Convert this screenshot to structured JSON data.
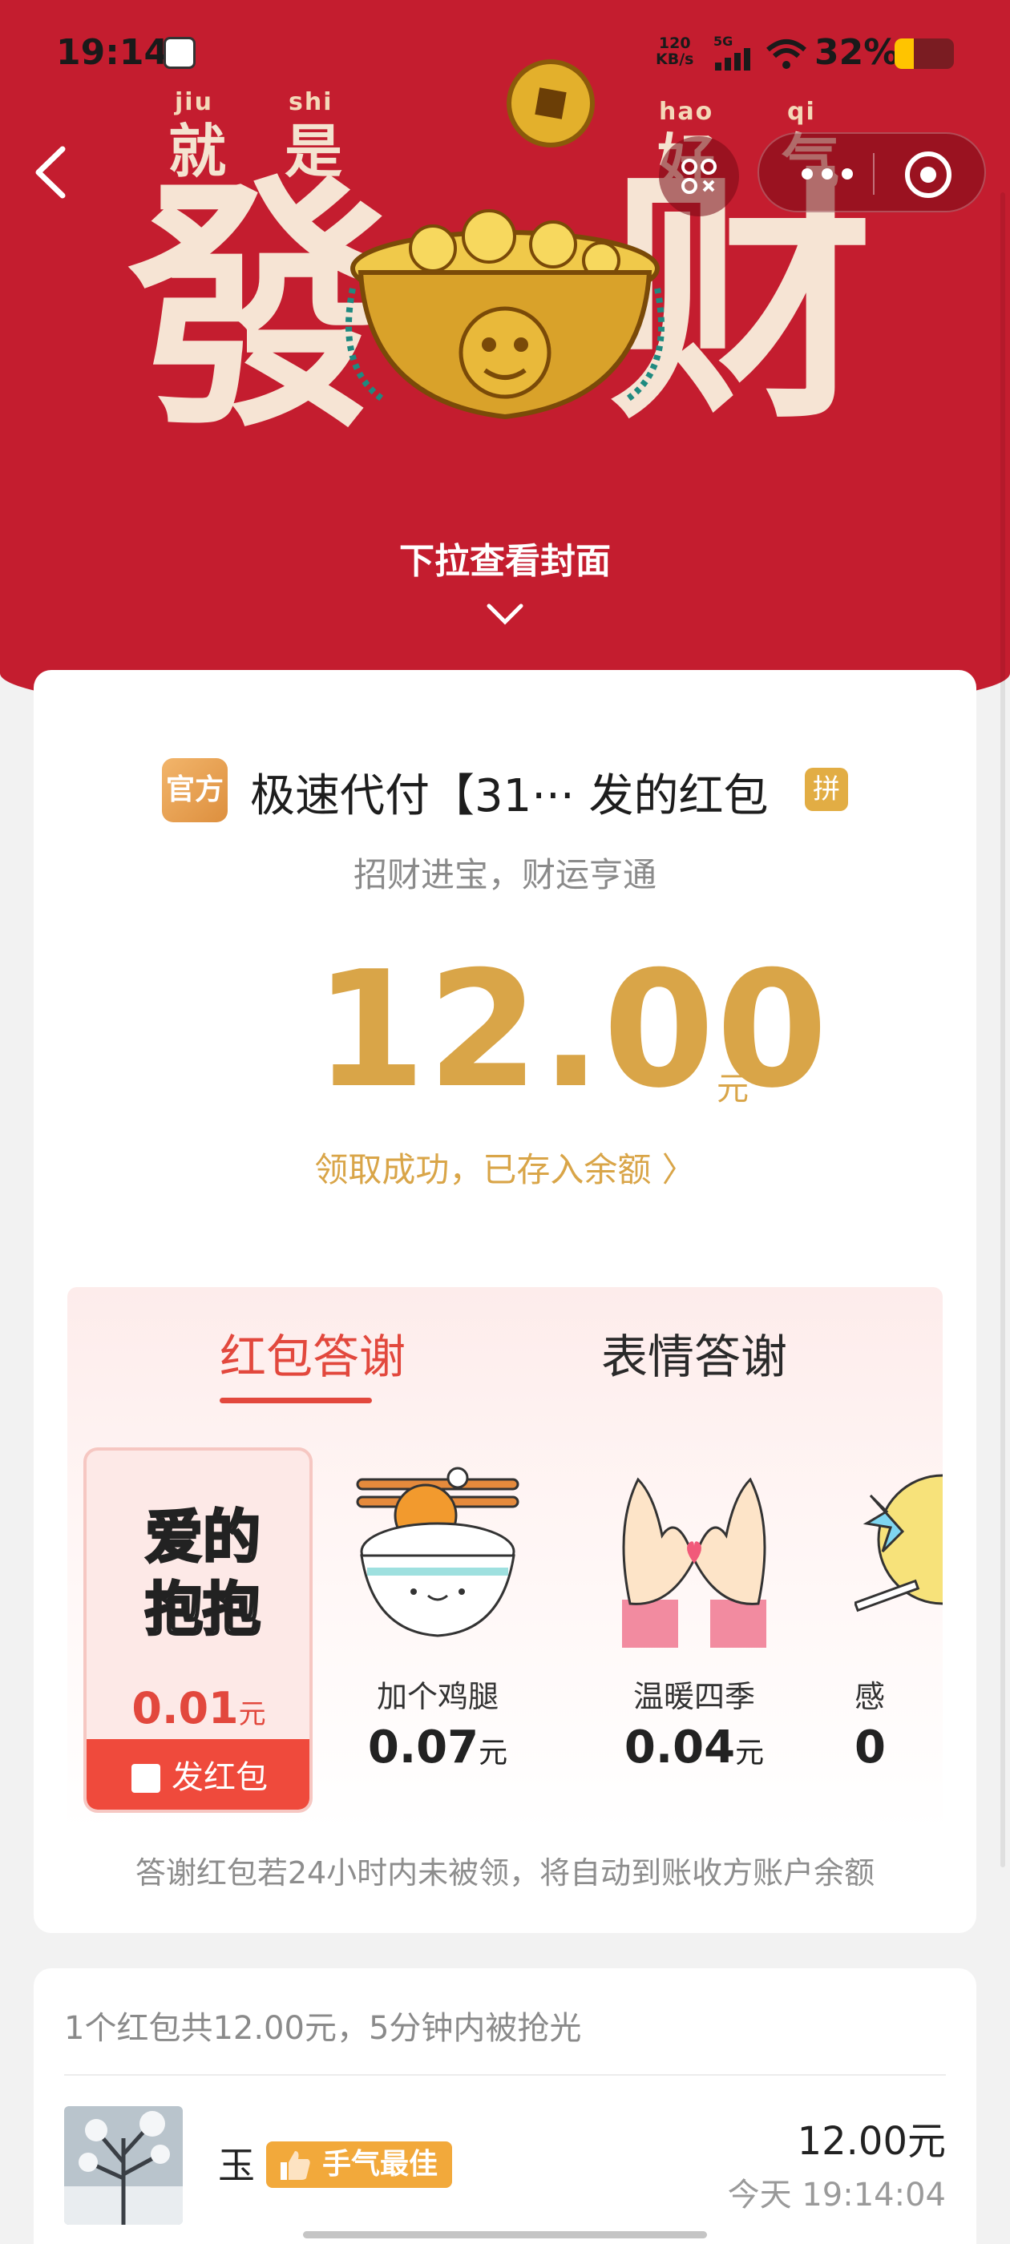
{
  "status_bar": {
    "time": "19:14",
    "net_speed_value": "120",
    "net_speed_unit": "KB/s",
    "network_type": "5G",
    "battery_percent": "32%",
    "battery_level": 0.32
  },
  "nav": {
    "back_icon": "chevron-left-icon",
    "more_icon": "more-dots-icon",
    "close_icon": "target-close-icon",
    "share_icon": "share-icon"
  },
  "cover": {
    "pinyin_1": "jiu",
    "pinyin_2": "shi",
    "pinyin_3": "hao",
    "pinyin_4": "qi",
    "char_1": "就",
    "char_2": "是",
    "char_3": "好",
    "char_4": "气",
    "big_left": "發",
    "big_right": "财"
  },
  "pull_hint": "下拉查看封面",
  "envelope": {
    "official_badge": "官方",
    "sender": "极速代付【31··· 发的红包",
    "pin_badge": "拼",
    "greeting": "招财进宝，财运亨通",
    "amount": "12.00",
    "amount_unit": "元",
    "received_text": "领取成功，已存入余额 〉"
  },
  "thanks": {
    "tabs": [
      {
        "label": "红包答谢",
        "active": true
      },
      {
        "label": "表情答谢",
        "active": false
      }
    ],
    "selected": {
      "sticker_line1": "爱的",
      "sticker_line2": "抱抱",
      "price": "0.01",
      "unit": "元",
      "send_label": "发红包"
    },
    "items": [
      {
        "label": "加个鸡腿",
        "price": "0.07",
        "unit": "元"
      },
      {
        "label": "温暖四季",
        "price": "0.04",
        "unit": "元"
      },
      {
        "label": "感",
        "price": "0",
        "unit": ""
      }
    ],
    "note": "答谢红包若24小时内未被领，将自动到账收方账户余额"
  },
  "records": {
    "summary": "1个红包共12.00元，5分钟内被抢光",
    "items": [
      {
        "name": "玉",
        "badge": "手气最佳",
        "amount": "12.00元",
        "time": "今天 19:14:04"
      }
    ]
  },
  "colors": {
    "header_red": "#c41d2f",
    "gold": "#d9a548",
    "accent_red": "#e2483d",
    "badge_orange": "#f2a93b"
  }
}
